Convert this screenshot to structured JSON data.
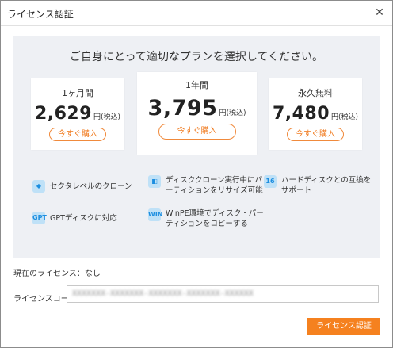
{
  "window": {
    "title": "ライセンス認証",
    "close_glyph": "✕"
  },
  "headline": "ご自身にとって適切なプランを選択してください。",
  "plans": [
    {
      "name": "1ヶ月間",
      "price": "2,629",
      "unit": "円(税込)",
      "buy_label": "今すぐ購入"
    },
    {
      "name": "1年間",
      "price": "3,795",
      "unit": "円(税込)",
      "buy_label": "今すぐ購入"
    },
    {
      "name": "永久無料",
      "price": "7,480",
      "unit": "円(税込)",
      "buy_label": "今すぐ購入"
    }
  ],
  "features": [
    {
      "icon": "sector-clone-icon",
      "glyph": "◆",
      "text": "セクタレベルのクローン"
    },
    {
      "icon": "disk-clone-icon",
      "glyph": "◧",
      "text": "ディスククローン実行中にパーティションをリサイズ可能"
    },
    {
      "icon": "hdd-compat-icon",
      "glyph": "16",
      "text": "ハードディスクとの互換をサポート"
    },
    {
      "icon": "gpt-icon",
      "glyph": "GPT",
      "text": "GPTディスクに対応"
    },
    {
      "icon": "winpe-icon",
      "glyph": "WIN",
      "text": "WinPE環境でディスク・パーティションをコピーする"
    }
  ],
  "license": {
    "status_label": "現在のライセンス：",
    "status_value": "なし",
    "code_label": "ライセンスコード:",
    "code_value": "XXXXXXX-XXXXXXX-XXXXXXX-XXXXXXX-XXXXXX"
  },
  "actions": {
    "activate_label": "ライセンス認証"
  },
  "colors": {
    "accent": "#f5811f",
    "panel_bg": "#eef0f4",
    "icon_bg": "#bfe1f7",
    "icon_fg": "#1c8ee0"
  }
}
